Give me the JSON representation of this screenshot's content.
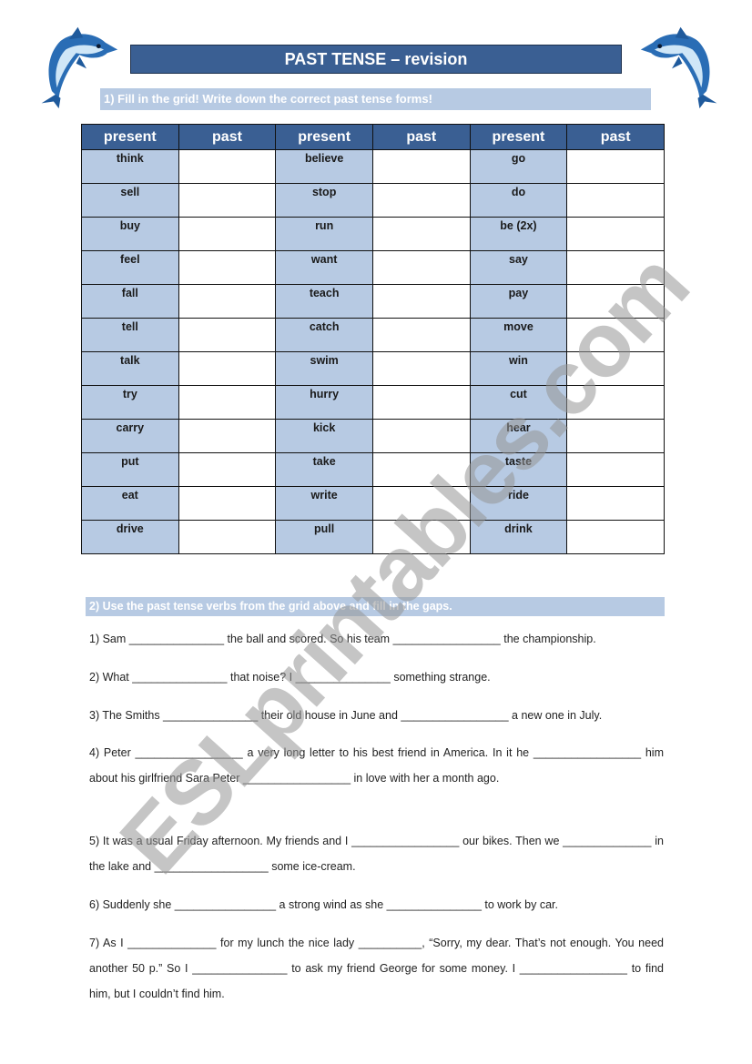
{
  "header": {
    "title": "PAST TENSE – revision",
    "decoration_icon": "dolphin-icon"
  },
  "section1": {
    "instruction": "1) Fill in the grid! Write down the correct past tense forms!",
    "columns": [
      "present",
      "past",
      "present",
      "past",
      "present",
      "past"
    ],
    "rows": [
      [
        "think",
        "believe",
        "go"
      ],
      [
        "sell",
        "stop",
        "do"
      ],
      [
        "buy",
        "run",
        "be (2x)"
      ],
      [
        "feel",
        "want",
        "say"
      ],
      [
        "fall",
        "teach",
        "pay"
      ],
      [
        "tell",
        "catch",
        "move"
      ],
      [
        "talk",
        "swim",
        "win"
      ],
      [
        "try",
        "hurry",
        "cut"
      ],
      [
        "carry",
        "kick",
        "hear"
      ],
      [
        "put",
        "take",
        "taste"
      ],
      [
        "eat",
        "write",
        "ride"
      ],
      [
        "drive",
        "pull",
        "drink"
      ]
    ]
  },
  "section2": {
    "instruction": "2) Use the past tense verbs from the grid above and fill in the gaps.",
    "sentences": [
      "1) Sam _______________ the ball and scored. So his team _________________ the championship.",
      "2) What _______________ that noise? I _______________ something strange.",
      "3) The Smiths _______________ their old house in June and _________________ a new one in July.",
      "4) Peter _________________ a very long letter to his best friend in America. In it he _________________ him about his girlfriend Sara Peter _________________ in love with her a month ago.",
      "5) It was a usual Friday afternoon. My friends and I _________________ our bikes. Then we ______________ in the lake and __________________ some ice-cream.",
      "6) Suddenly she ________________ a strong wind as she _______________ to work by car.",
      "7) As I ______________ for my lunch the nice lady __________, “Sorry, my dear. That’s not enough. You need another 50 p.” So I _______________ to ask my friend George for some money. I _________________ to find him, but I couldn’t find him."
    ]
  },
  "watermark": "ESLprintables.com",
  "colors": {
    "header_blue": "#3a5f93",
    "light_blue": "#b7cae3"
  }
}
